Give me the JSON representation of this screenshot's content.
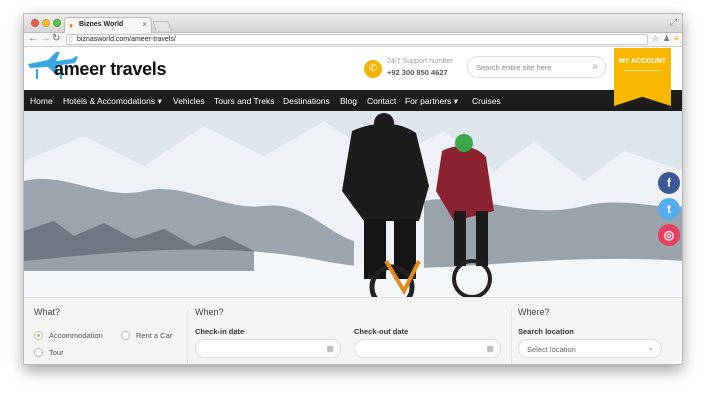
{
  "browser": {
    "tab_title": "Biznes World",
    "url": "biznasworld.com/ameer-travels/"
  },
  "header": {
    "logo_text": "ameer travels",
    "support_label": "24/7 Support number",
    "support_phone": "+92 300 850 4627",
    "search_placeholder": "Search entire site here",
    "my_account": "MY ACCOUNT"
  },
  "nav": {
    "items": [
      {
        "label": "Home"
      },
      {
        "label": "Hotels & Accomodations ▾"
      },
      {
        "label": "Vehicles"
      },
      {
        "label": "Tours and Treks"
      },
      {
        "label": "Destinations"
      },
      {
        "label": "Blog"
      },
      {
        "label": "Contact"
      },
      {
        "label": "For partners ▾"
      },
      {
        "label": "Cruises"
      }
    ]
  },
  "social": {
    "facebook": "f",
    "twitter": "t",
    "instagram": "◎"
  },
  "booking": {
    "what": {
      "heading": "What?",
      "options": [
        {
          "label": "Accommodation",
          "selected": true
        },
        {
          "label": "Rent a Car",
          "selected": false
        },
        {
          "label": "Tour",
          "selected": false
        }
      ]
    },
    "when": {
      "heading": "When?",
      "checkin_label": "Check-in date",
      "checkout_label": "Check-out date"
    },
    "where": {
      "heading": "Where?",
      "location_label": "Search location",
      "location_value": "Select location"
    }
  }
}
